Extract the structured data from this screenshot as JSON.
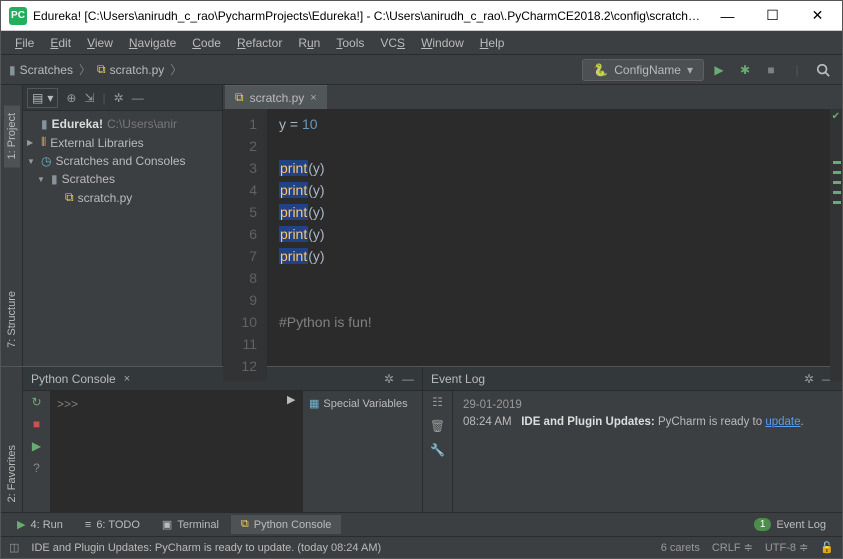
{
  "window": {
    "title": "Edureka! [C:\\Users\\anirudh_c_rao\\PycharmProjects\\Edureka!] - C:\\Users\\anirudh_c_rao\\.PyCharmCE2018.2\\config\\scratches\\s..."
  },
  "menu": [
    "File",
    "Edit",
    "View",
    "Navigate",
    "Code",
    "Refactor",
    "Run",
    "Tools",
    "VCS",
    "Window",
    "Help"
  ],
  "breadcrumb": {
    "folder": "Scratches",
    "file": "scratch.py"
  },
  "run_config": "ConfigName",
  "side_tabs": {
    "project": "1: Project",
    "structure": "7: Structure",
    "favorites": "2: Favorites"
  },
  "tree": {
    "root": "Edureka!",
    "root_path": "C:\\Users\\anir",
    "ext_lib": "External Libraries",
    "sc_consoles": "Scratches and Consoles",
    "scratches": "Scratches",
    "file": "scratch.py"
  },
  "editor": {
    "tab_name": "scratch.py",
    "lines": [
      "1",
      "2",
      "3",
      "4",
      "5",
      "6",
      "7",
      "8",
      "9",
      "10",
      "11",
      "12"
    ],
    "code": {
      "l1_var": "y",
      "l1_eq": " = ",
      "l1_val": "10",
      "print": "print",
      "arg": "(y)",
      "comment": "#Python is fun!"
    }
  },
  "console": {
    "title": "Python Console",
    "prompt": ">>>",
    "special": "Special Variables"
  },
  "eventlog": {
    "title": "Event Log",
    "date": "29-01-2019",
    "time": "08:24 AM",
    "head": "IDE and Plugin Updates:",
    "body": " PyCharm is ready to ",
    "link": "update",
    "dot": "."
  },
  "bottom_tabs": {
    "run": "4: Run",
    "todo": "6: TODO",
    "terminal": "Terminal",
    "console": "Python Console",
    "event": "Event Log",
    "badge": "1"
  },
  "status": {
    "msg": "IDE and Plugin Updates: PyCharm is ready to update. (today 08:24 AM)",
    "carets": "6 carets",
    "crlf": "CRLF",
    "enc": "UTF-8"
  }
}
